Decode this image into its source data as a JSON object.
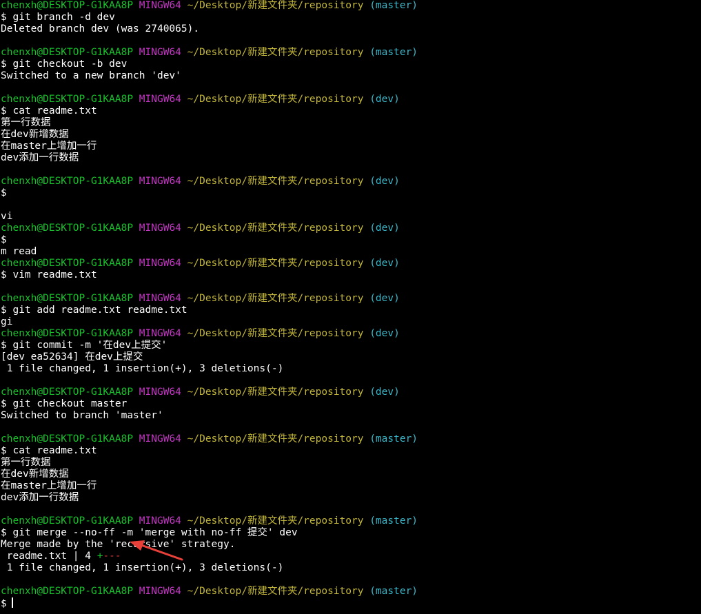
{
  "prompt": {
    "user_host": "chenxh@DESKTOP-G1KAA8P",
    "system": "MINGW64",
    "path": "~/Desktop/新建文件夹/repository",
    "dollar": "$"
  },
  "blocks": [
    {
      "branch": "(master)",
      "command": "git branch -d dev",
      "output": [
        "Deleted branch dev (was 2740065)."
      ]
    },
    {
      "branch": "(master)",
      "command": "git checkout -b dev",
      "output": [
        "Switched to a new branch 'dev'"
      ]
    },
    {
      "branch": "(dev)",
      "command": "cat readme.txt",
      "output": [
        "第一行数据",
        "在dev新增数据",
        "在master上增加一行",
        "dev添加一行数据"
      ]
    },
    {
      "branch": "(dev)",
      "command": "",
      "output": [
        "",
        "vi"
      ]
    },
    {
      "branch": "(dev)",
      "command": "",
      "output": [
        "m read"
      ]
    },
    {
      "branch": "(dev)",
      "command": "vim readme.txt",
      "output": [
        ""
      ]
    },
    {
      "branch": "(dev)",
      "command": "git add readme.txt readme.txt",
      "output": [
        "gi"
      ]
    },
    {
      "branch": "(dev)",
      "command": "git commit -m '在dev上提交'",
      "output": [
        "[dev ea52634] 在dev上提交",
        " 1 file changed, 1 insertion(+), 3 deletions(-)"
      ]
    },
    {
      "branch": "(dev)",
      "command": "git checkout master",
      "output": [
        "Switched to branch 'master'"
      ]
    },
    {
      "branch": "(master)",
      "command": "cat readme.txt",
      "output": [
        "第一行数据",
        "在dev新增数据",
        "在master上增加一行",
        "dev添加一行数据"
      ]
    },
    {
      "branch": "(master)",
      "command": "git merge --no-ff -m 'merge with no-ff 提交' dev",
      "output": [
        "Merge made by the 'recursive' strategy."
      ]
    },
    {
      "branch": "(master)",
      "command": "",
      "output": []
    }
  ],
  "diffstat": {
    "file": " readme.txt | 4 ",
    "plus": "+",
    "minus": "---",
    "summary": " 1 file changed, 1 insertion(+), 3 deletions(-)"
  },
  "colors": {
    "user": "#17c12b",
    "system": "#c436c4",
    "path": "#c2b63a",
    "branch": "#3bb7c9",
    "arrow": "#e8413a"
  }
}
